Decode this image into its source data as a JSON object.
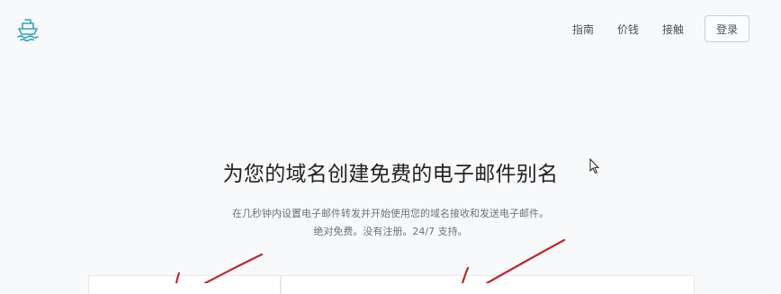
{
  "header": {
    "logo_icon": "ship-logo-icon",
    "nav": [
      {
        "label": "指南"
      },
      {
        "label": "价钱"
      },
      {
        "label": "接触"
      }
    ],
    "login_label": "登录"
  },
  "hero": {
    "title": "为您的域名创建免费的电子邮件别名",
    "subtitle_line1": "在几秒钟内设置电子邮件转发并开始使用您的域名接收和发送电子邮件。",
    "subtitle_line2": "绝对免费。没有注册。24/7 支持。"
  },
  "colors": {
    "accent": "#2aa7b8",
    "annotation": "#c0262a",
    "background": "#f8f9fb"
  }
}
